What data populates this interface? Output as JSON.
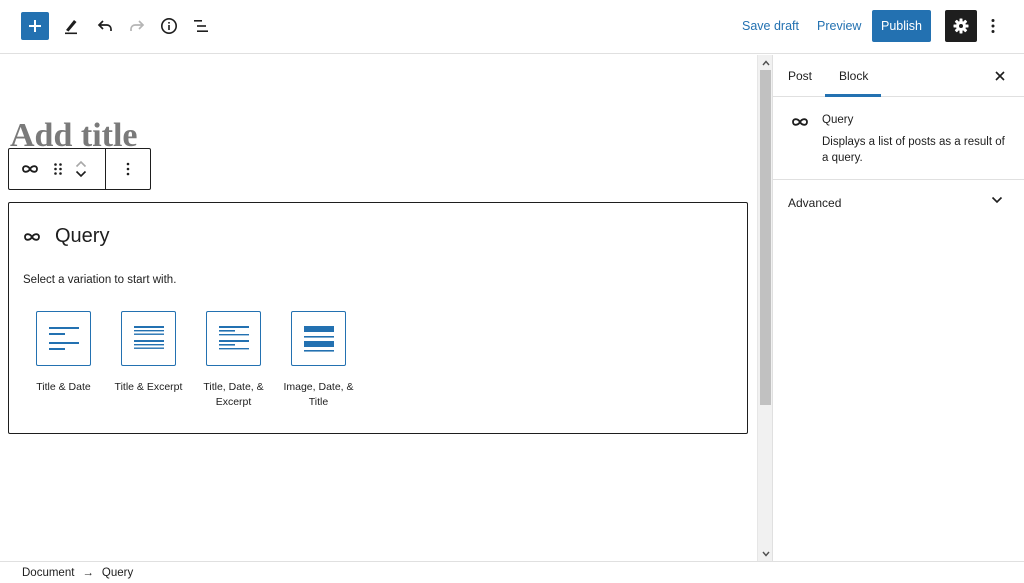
{
  "toolbar": {
    "add_block_icon": "plus-icon",
    "tools_icon": "pencil-icon",
    "undo_icon": "undo-icon",
    "redo_icon": "redo-icon",
    "details_icon": "info-icon",
    "outline_icon": "list-view-icon",
    "save_draft": "Save draft",
    "preview": "Preview",
    "publish": "Publish",
    "settings_icon": "gear-icon",
    "more_icon": "more-vertical-icon",
    "accent_color": "#2371b1"
  },
  "editor": {
    "title_placeholder": "Add title",
    "block_toolbar": {
      "block_icon": "query-loop-icon",
      "drag_icon": "drag-handle-icon",
      "move_up_icon": "chevron-up-icon",
      "move_down_icon": "chevron-down-icon",
      "options_icon": "more-vertical-icon"
    },
    "query_block": {
      "icon": "query-loop-icon",
      "title": "Query",
      "instructions": "Select a variation to start with.",
      "variations": [
        {
          "label": "Title & Date",
          "icon": "title-date-icon"
        },
        {
          "label": "Title & Excerpt",
          "icon": "title-excerpt-icon"
        },
        {
          "label": "Title, Date, & Excerpt",
          "icon": "title-date-excerpt-icon"
        },
        {
          "label": "Image, Date, & Title",
          "icon": "image-date-title-icon"
        }
      ]
    }
  },
  "sidebar": {
    "tabs": [
      {
        "label": "Post",
        "active": false
      },
      {
        "label": "Block",
        "active": true
      }
    ],
    "close_icon": "close-icon",
    "block_card": {
      "icon": "query-loop-icon",
      "title": "Query",
      "description": "Displays a list of posts as a result of a query."
    },
    "panels": [
      {
        "title": "Advanced",
        "icon": "chevron-down-icon",
        "expanded": false
      }
    ]
  },
  "footer": {
    "breadcrumbs": [
      "Document",
      "Query"
    ],
    "separator": "→"
  }
}
